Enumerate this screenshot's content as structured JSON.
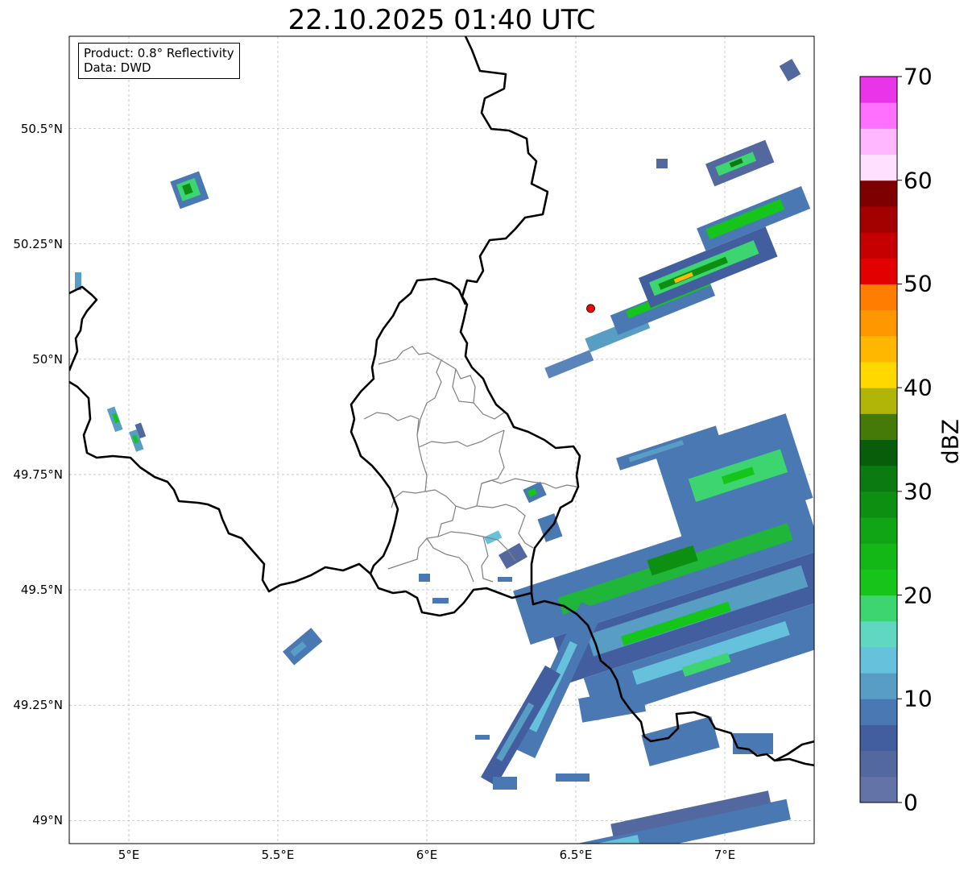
{
  "title": "22.10.2025 01:40 UTC",
  "info": {
    "product": "Product: 0.8° Reflectivity",
    "data_source": "Data: DWD"
  },
  "x_ticks": [
    {
      "lon": 5.0,
      "label": "5°E"
    },
    {
      "lon": 5.5,
      "label": "5.5°E"
    },
    {
      "lon": 6.0,
      "label": "6°E"
    },
    {
      "lon": 6.5,
      "label": "6.5°E"
    },
    {
      "lon": 7.0,
      "label": "7°E"
    }
  ],
  "y_ticks": [
    {
      "lat": 50.5,
      "label": "50.5°N"
    },
    {
      "lat": 50.25,
      "label": "50.25°N"
    },
    {
      "lat": 50.0,
      "label": "50°N"
    },
    {
      "lat": 49.75,
      "label": "49.75°N"
    },
    {
      "lat": 49.5,
      "label": "49.5°N"
    },
    {
      "lat": 49.25,
      "label": "49.25°N"
    },
    {
      "lat": 49.0,
      "label": "49°N"
    }
  ],
  "extent": {
    "lon_min": 4.8,
    "lon_max": 7.3,
    "lat_min": 48.95,
    "lat_max": 50.7
  },
  "radar_site": {
    "lon": 6.55,
    "lat": 50.11,
    "color": "#ff0000"
  },
  "colorbar": {
    "label": "dBZ",
    "min": 0,
    "max": 70,
    "ticks": [
      {
        "value": 0,
        "label": "0"
      },
      {
        "value": 10,
        "label": "10"
      },
      {
        "value": 20,
        "label": "20"
      },
      {
        "value": 30,
        "label": "30"
      },
      {
        "value": 40,
        "label": "40"
      },
      {
        "value": 50,
        "label": "50"
      },
      {
        "value": 60,
        "label": "60"
      },
      {
        "value": 70,
        "label": "70"
      }
    ],
    "colors": [
      "#6373a8",
      "#53689f",
      "#425e9f",
      "#4978b2",
      "#579dc4",
      "#66c1dc",
      "#5fd7c1",
      "#3dd570",
      "#15c51a",
      "#13b716",
      "#10a514",
      "#0d8f12",
      "#0b7a10",
      "#075d0a",
      "#467a08",
      "#b0b507",
      "#ffd800",
      "#ffb700",
      "#ff9800",
      "#ff7d00",
      "#e20000",
      "#c60000",
      "#a30000",
      "#7e0000",
      "#ffe0ff",
      "#ffb7ff",
      "#ff70ff",
      "#ea34ea"
    ]
  },
  "colors": {
    "border": "#000000",
    "admin": "#808080",
    "grid": "#bfbfbf"
  }
}
